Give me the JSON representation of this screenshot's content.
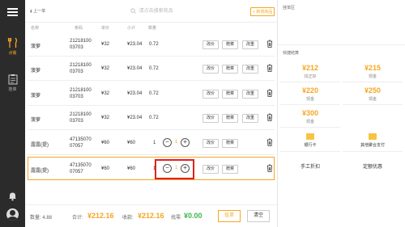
{
  "sidebar": {
    "items": [
      {
        "label": "点餐",
        "icon": "fork-knife-icon",
        "active": true
      },
      {
        "label": "挂单",
        "icon": "clipboard-icon",
        "active": false
      }
    ]
  },
  "topbar": {
    "back_label": "上一单",
    "search_placeholder": "请点击搜索商品",
    "add_label": "+ 新增商品"
  },
  "table": {
    "headers": [
      "名称",
      "条码",
      "单价",
      "小计",
      "数量"
    ],
    "rows": [
      {
        "name": "菠萝",
        "code1": "21218100",
        "code2": "03703",
        "price": "¥32",
        "subtotal": "¥23.04",
        "qty": "0.72",
        "actions": [
          "改价",
          "赠菜",
          "改重"
        ]
      },
      {
        "name": "菠萝",
        "code1": "21218100",
        "code2": "03703",
        "price": "¥32",
        "subtotal": "¥23.04",
        "qty": "0.72",
        "actions": [
          "改价",
          "赠菜",
          "改重"
        ]
      },
      {
        "name": "菠萝",
        "code1": "21218100",
        "code2": "03703",
        "price": "¥32",
        "subtotal": "¥23.04",
        "qty": "0.72",
        "actions": [
          "改价",
          "赠菜",
          "改重"
        ]
      },
      {
        "name": "菠萝",
        "code1": "21218100",
        "code2": "03703",
        "price": "¥32",
        "subtotal": "¥23.04",
        "qty": "0.72",
        "actions": [
          "改价",
          "赠菜",
          "改重"
        ]
      },
      {
        "name": "露露(提)",
        "code1": "47135070",
        "code2": "07057",
        "price": "¥60",
        "subtotal": "¥60",
        "qty": "1",
        "stepper_value": "1",
        "actions": [
          "改价",
          "赠菜"
        ]
      },
      {
        "name": "露露(提)",
        "code1": "47135070",
        "code2": "07057",
        "price": "¥60",
        "subtotal": "¥60",
        "qty": "1",
        "stepper_value": "1",
        "actions": [
          "改价",
          "赠菜"
        ]
      }
    ]
  },
  "footer": {
    "count_label": "数量: 4.88",
    "total_label": "合计:",
    "total_value": "¥212.16",
    "received_label": "收款:",
    "received_value": "¥212.16",
    "change_label": "找零:",
    "change_value": "¥0.00",
    "hang_label": "挂单",
    "clear_label": "清空"
  },
  "right": {
    "hang_title": "挂单区",
    "checkout_title": "快捷结算",
    "payments": [
      {
        "amount": "¥212",
        "label": "现金"
      },
      {
        "amount": "¥215",
        "label": "现金"
      },
      {
        "amount": "¥220",
        "label": "现金"
      },
      {
        "amount": "¥250",
        "label": "现金"
      },
      {
        "amount": "¥300",
        "label": "现金"
      }
    ],
    "first_label": "找正好",
    "card_label": "银行卡",
    "other_label": "其他聚合支付",
    "manual_discount": "手工折扣",
    "fixed_discount": "定额优惠"
  },
  "colors": {
    "accent": "#f5a623",
    "sidebar": "#2b2b2b",
    "highlight": "#e02020",
    "change": "#3bb54a"
  }
}
